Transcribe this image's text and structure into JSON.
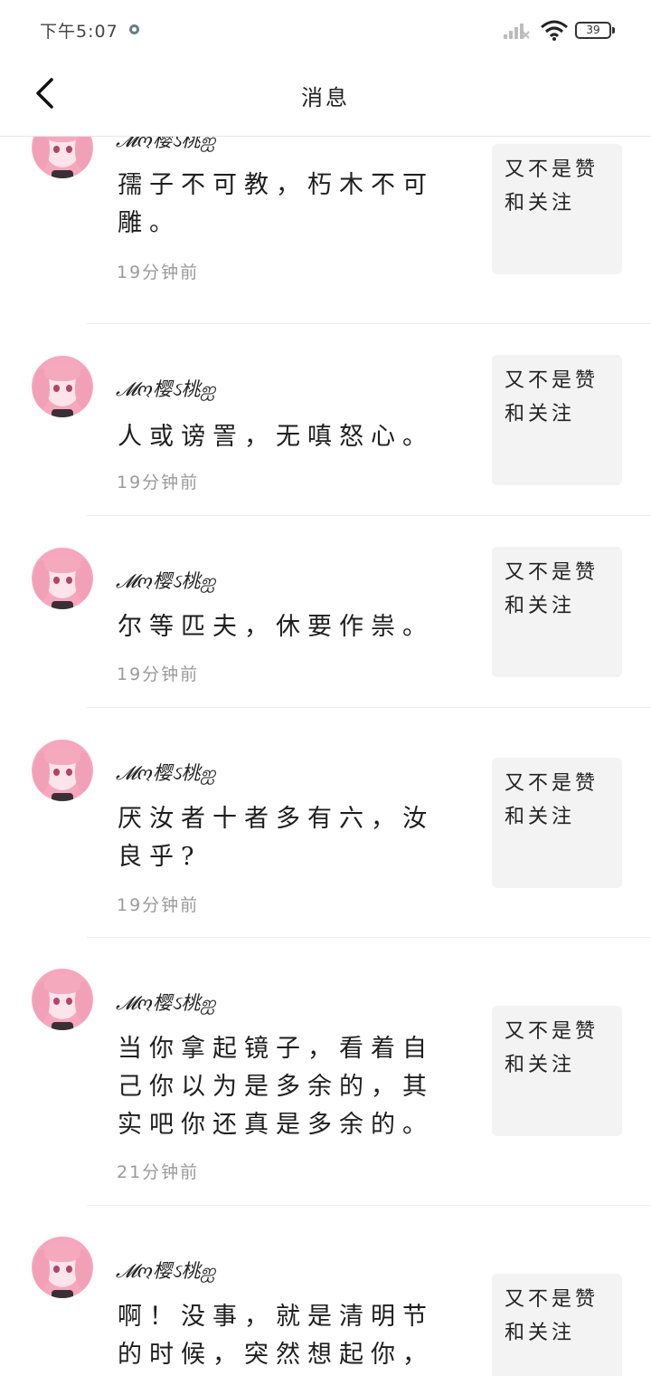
{
  "status_bar": {
    "time": "下午5:07",
    "battery": "39"
  },
  "header": {
    "title": "消息"
  },
  "messages": [
    {
      "username": "𝓜ო樱ઽ桃ஐ",
      "comment": "孺子不可教，朽木不可雕。",
      "time": "19分钟前",
      "preview": "又不是赞和关注"
    },
    {
      "username": "𝓜ო樱ઽ桃ஐ",
      "comment": "人或谤詈，无嗔怒心。",
      "time": "19分钟前",
      "preview": "又不是赞和关注"
    },
    {
      "username": "𝓜ო樱ઽ桃ஐ",
      "comment": "尔等匹夫，休要作祟。",
      "time": "19分钟前",
      "preview": "又不是赞和关注"
    },
    {
      "username": "𝓜ო樱ઽ桃ஐ",
      "comment": "厌汝者十者多有六，汝良乎?",
      "time": "19分钟前",
      "preview": "又不是赞和关注"
    },
    {
      "username": "𝓜ო樱ઽ桃ஐ",
      "comment": "当你拿起镜子，看着自己你以为是多余的，其实吧你还真是多余的。",
      "time": "21分钟前",
      "preview": "又不是赞和关注"
    },
    {
      "username": "𝓜ო樱ઽ桃ஐ",
      "comment": "啊！没事，就是清明节的时候，突然想起你，为什",
      "time": "",
      "preview": "又不是赞和关注"
    }
  ]
}
